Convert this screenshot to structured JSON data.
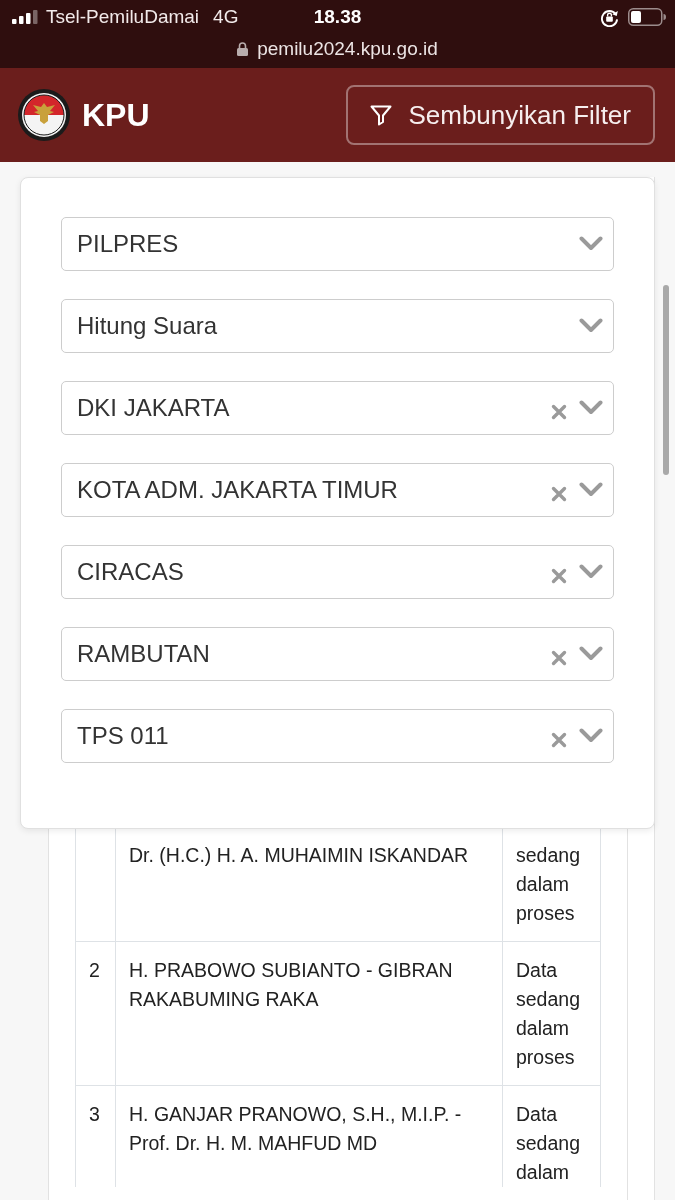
{
  "status_bar": {
    "carrier": "Tsel-PemiluDamai",
    "network": "4G",
    "time": "18.38"
  },
  "address_bar": {
    "url": "pemilu2024.kpu.go.id"
  },
  "header": {
    "title": "KPU",
    "filter_button": "Sembunyikan Filter"
  },
  "filters": [
    {
      "value": "PILPRES",
      "clearable": false
    },
    {
      "value": "Hitung Suara",
      "clearable": false
    },
    {
      "value": "DKI JAKARTA",
      "clearable": true
    },
    {
      "value": "KOTA ADM. JAKARTA TIMUR",
      "clearable": true
    },
    {
      "value": "CIRACAS",
      "clearable": true
    },
    {
      "value": "RAMBUTAN",
      "clearable": true
    },
    {
      "value": "TPS 011",
      "clearable": true
    }
  ],
  "table": {
    "rows": [
      {
        "name": "Dr. (H.C.) H. A. MUHAIMIN ISKANDAR",
        "status": "sedang dalam proses"
      },
      {
        "number": "2",
        "name": "H. PRABOWO SUBIANTO - GIBRAN RAKABUMING RAKA",
        "status": "Data sedang dalam proses"
      },
      {
        "number": "3",
        "name": "H. GANJAR PRANOWO, S.H., M.I.P. - Prof. Dr. H. M. MAHFUD MD",
        "status": "Data sedang dalam"
      }
    ]
  }
}
